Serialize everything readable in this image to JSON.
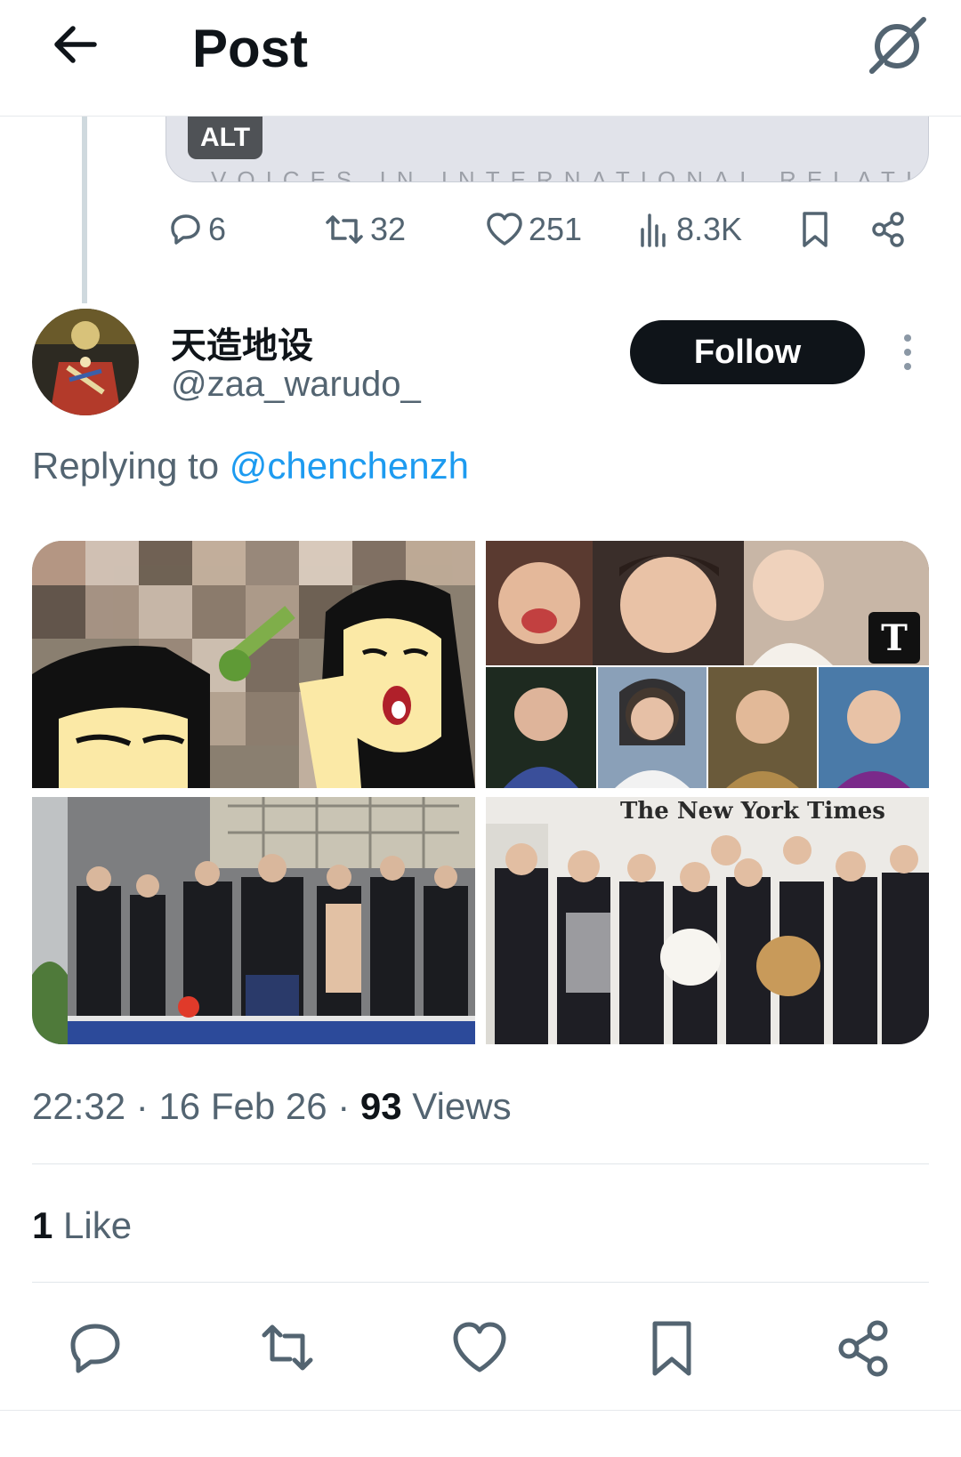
{
  "header": {
    "title": "Post"
  },
  "quote": {
    "alt_label": "ALT",
    "caption": "VOICES IN INTERNATIONAL RELATIONS"
  },
  "parent_actions": {
    "replies": "6",
    "reposts": "32",
    "likes": "251",
    "views": "8.3K"
  },
  "author": {
    "display_name": "天造地设",
    "handle": "@zaa_warudo_",
    "follow_label": "Follow"
  },
  "reply": {
    "prefix": "Replying to ",
    "mention": "@chenchenzh"
  },
  "media": {
    "top_right_badge": "T",
    "bottom_right_banner": "The New York Times"
  },
  "meta": {
    "time": "22:32",
    "sep1": " · ",
    "date": "16 Feb 26",
    "sep2": " · ",
    "views_count": "93",
    "views_label": " Views"
  },
  "likes": {
    "count": "1",
    "label": " Like"
  },
  "colors": {
    "accent": "#1d9bf0",
    "text": "#0f1419",
    "secondary": "#536471",
    "follow_bg": "#0f1419"
  }
}
